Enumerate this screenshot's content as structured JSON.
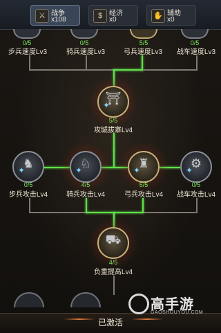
{
  "tabs": [
    {
      "name": "战争",
      "count": "x108",
      "icon": "crossed-swords-icon",
      "active": true
    },
    {
      "name": "经济",
      "count": "x0",
      "icon": "money-bag-icon",
      "active": false
    },
    {
      "name": "辅助",
      "count": "x0",
      "icon": "hand-icon",
      "active": false
    }
  ],
  "row1": [
    {
      "progress": "0/5",
      "label": "步兵速度Lv3"
    },
    {
      "progress": "0/5",
      "label": "骑兵速度Lv3"
    },
    {
      "progress": "5/5",
      "label": "弓兵速度Lv3"
    },
    {
      "progress": "0/5",
      "label": "战车速度Lv3"
    }
  ],
  "siege": {
    "progress": "5/5",
    "label": "攻城拔寨Lv4"
  },
  "row3": [
    {
      "progress": "0/5",
      "label": "步兵攻击Lv4"
    },
    {
      "progress": "4/5",
      "label": "骑兵攻击Lv4"
    },
    {
      "progress": "5/5",
      "label": "弓兵攻击Lv4"
    },
    {
      "progress": "0/5",
      "label": "战车攻击Lv4"
    }
  ],
  "load": {
    "progress": "4/5",
    "label": "负重提高Lv4"
  },
  "bottom": {
    "status": "已激活"
  },
  "watermark": {
    "cn": "高手游",
    "en": "GAOSHOUYOU.COM"
  },
  "colors": {
    "active_line": "#5fe14a",
    "progress_text": "#7be85e"
  }
}
